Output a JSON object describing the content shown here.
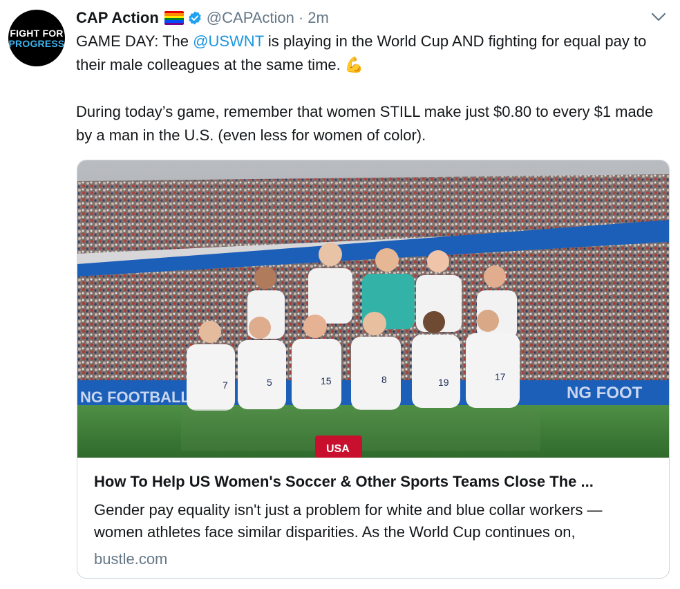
{
  "avatar": {
    "line1": "FIGHT FOR",
    "line2": "PROGRESS"
  },
  "tweet": {
    "name": "CAP Action",
    "handle": "@CAPAction",
    "separator": "·",
    "time": "2m",
    "text1_part1": "GAME DAY: The ",
    "text1_mention": "@USWNT",
    "text1_part2": " is playing in the World Cup AND fighting for equal pay to their male colleagues at the same time. ",
    "text1_emoji": "💪",
    "text2": "During today’s game, remember that women STILL make just $0.80 to every $1 made by a man in the U.S. (even less for women of color)."
  },
  "card": {
    "title": "How To Help US Women's Soccer & Other Sports Teams Close The ...",
    "description": "Gender pay equality isn't just a problem for white and blue collar workers — women athletes face similar disparities. As the World Cup continues on,",
    "domain": "bustle.com",
    "banner_left": "NG FOOTBALL",
    "banner_right": "NG FOOT",
    "ball_text": "USA",
    "jersey_numbers": [
      "7",
      "5",
      "15",
      "8",
      "19",
      "17"
    ]
  },
  "colors": {
    "link": "#1b95e0",
    "muted": "#657786",
    "verified": "#1da1f2",
    "pitch": "#3f7d3a",
    "ad_board": "#1c5fb8",
    "rainbow": [
      "#e40303",
      "#ff8c00",
      "#ffed00",
      "#008026",
      "#004dff",
      "#750787"
    ]
  },
  "icons": {
    "verified": "verified-badge-icon",
    "caret": "chevron-down-icon",
    "flag": "rainbow-flag-icon"
  }
}
